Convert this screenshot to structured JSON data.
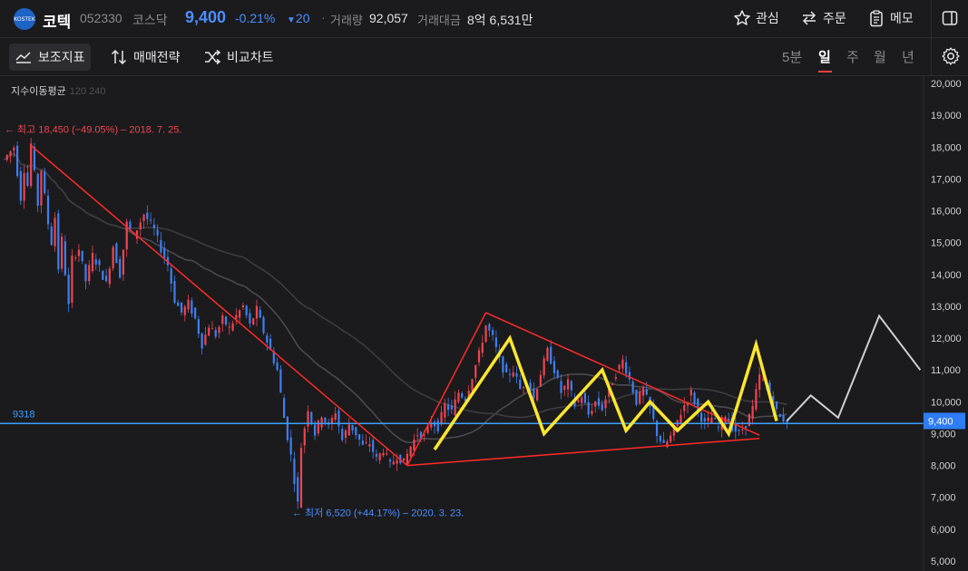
{
  "header": {
    "logo_text": "KOSTEK",
    "name": "코텍",
    "code": "052330",
    "market": "코스닥",
    "price": "9,400",
    "change_pct": "-0.21%",
    "change_arrow": "▼",
    "change_abs": "20",
    "separator": "·",
    "volume_label": "거래량",
    "volume": "92,057",
    "amount_label": "거래대금",
    "amount": "8억 6,531만",
    "watch_label": "관심",
    "order_label": "주문",
    "memo_label": "메모"
  },
  "toolbar": {
    "indicator_label": "보조지표",
    "strategy_label": "매매전략",
    "compare_label": "비교차트",
    "timeframes": [
      "5분",
      "일",
      "주",
      "월",
      "년"
    ],
    "selected_timeframe": "일"
  },
  "legend": {
    "ma_label": "지수이동평균",
    "ma_periods": "120 240"
  },
  "colors": {
    "up": "#f04452",
    "down": "#3f7ff0",
    "accent": "#4c8dff",
    "hline": "#3ba0ff",
    "trend": "#ff2a2a",
    "pattern": "#ffe62e",
    "projection": "#cfcfd2"
  },
  "chart_data": {
    "type": "candlestick",
    "y_axis": {
      "min": 5000,
      "max": 20000,
      "step": 1000,
      "position": "right",
      "tick_labels": [
        "20,000",
        "19,000",
        "18,000",
        "17,000",
        "16,000",
        "15,000",
        "14,000",
        "13,000",
        "12,000",
        "11,000",
        "10,000",
        "9,000",
        "8,000",
        "7,000",
        "6,000",
        "5,000"
      ]
    },
    "current_price": 9400,
    "current_price_label": "9,400",
    "horizontal_line": {
      "value": 9318,
      "label": "9318"
    },
    "annotations": {
      "high": {
        "text": "← 최고 18,450 (−49.05%) – 2018. 7. 25.",
        "value": 18450
      },
      "low": {
        "text": "← 최저 6,520 (+44.17%) – 2020. 3. 23.",
        "value": 6520
      }
    },
    "price_path": [
      [
        0,
        17600
      ],
      [
        3,
        18000
      ],
      [
        5,
        16400
      ],
      [
        6,
        17300
      ],
      [
        7,
        16800
      ],
      [
        8,
        18100
      ],
      [
        10,
        16200
      ],
      [
        11,
        17300
      ],
      [
        13,
        15600
      ],
      [
        14,
        15000
      ],
      [
        15,
        15800
      ],
      [
        16,
        14200
      ],
      [
        17,
        15100
      ],
      [
        19,
        13000
      ],
      [
        20,
        14500
      ],
      [
        22,
        14800
      ],
      [
        24,
        13800
      ],
      [
        26,
        14600
      ],
      [
        28,
        14200
      ],
      [
        30,
        13700
      ],
      [
        32,
        14900
      ],
      [
        34,
        14000
      ],
      [
        36,
        15600
      ],
      [
        38,
        15200
      ],
      [
        41,
        15900
      ],
      [
        44,
        15400
      ],
      [
        46,
        14800
      ],
      [
        48,
        14300
      ],
      [
        50,
        13200
      ],
      [
        52,
        12800
      ],
      [
        54,
        13100
      ],
      [
        56,
        12600
      ],
      [
        58,
        11800
      ],
      [
        60,
        12400
      ],
      [
        62,
        12100
      ],
      [
        64,
        12600
      ],
      [
        66,
        12300
      ],
      [
        68,
        12700
      ],
      [
        70,
        13000
      ],
      [
        72,
        12400
      ],
      [
        74,
        12900
      ],
      [
        76,
        12200
      ],
      [
        78,
        11600
      ],
      [
        80,
        11000
      ],
      [
        82,
        9500
      ],
      [
        84,
        8300
      ],
      [
        86,
        6800
      ],
      [
        87,
        8600
      ],
      [
        89,
        9800
      ],
      [
        91,
        9000
      ],
      [
        93,
        9600
      ],
      [
        95,
        9200
      ],
      [
        97,
        9700
      ],
      [
        99,
        8800
      ],
      [
        101,
        9300
      ],
      [
        103,
        9000
      ],
      [
        105,
        8600
      ],
      [
        107,
        8700
      ],
      [
        109,
        8200
      ],
      [
        111,
        8500
      ],
      [
        113,
        8000
      ],
      [
        115,
        8300
      ],
      [
        117,
        8100
      ],
      [
        119,
        8600
      ],
      [
        121,
        9000
      ],
      [
        123,
        8900
      ],
      [
        125,
        9400
      ],
      [
        127,
        9200
      ],
      [
        129,
        9900
      ],
      [
        131,
        9700
      ],
      [
        133,
        10300
      ],
      [
        135,
        10100
      ],
      [
        137,
        10800
      ],
      [
        139,
        11500
      ],
      [
        141,
        12400
      ],
      [
        143,
        12000
      ],
      [
        145,
        11300
      ],
      [
        147,
        10800
      ],
      [
        149,
        11000
      ],
      [
        151,
        10400
      ],
      [
        153,
        10700
      ],
      [
        155,
        10100
      ],
      [
        157,
        10900
      ],
      [
        159,
        11600
      ],
      [
        161,
        11000
      ],
      [
        163,
        10300
      ],
      [
        165,
        10600
      ],
      [
        167,
        9900
      ],
      [
        169,
        10200
      ],
      [
        171,
        9600
      ],
      [
        173,
        10000
      ],
      [
        175,
        9800
      ],
      [
        177,
        10400
      ],
      [
        179,
        10900
      ],
      [
        181,
        11300
      ],
      [
        183,
        10700
      ],
      [
        185,
        10000
      ],
      [
        187,
        10400
      ],
      [
        189,
        9800
      ],
      [
        191,
        9000
      ],
      [
        193,
        8600
      ],
      [
        195,
        8900
      ],
      [
        197,
        9400
      ],
      [
        199,
        9900
      ],
      [
        201,
        10300
      ],
      [
        203,
        9700
      ],
      [
        205,
        9300
      ],
      [
        207,
        9500
      ],
      [
        209,
        9200
      ],
      [
        211,
        9600
      ],
      [
        213,
        9200
      ],
      [
        215,
        9000
      ],
      [
        217,
        9300
      ],
      [
        219,
        9800
      ],
      [
        221,
        10800
      ],
      [
        223,
        10500
      ],
      [
        225,
        9900
      ],
      [
        227,
        9500
      ],
      [
        229,
        9400
      ]
    ],
    "trend_lines": [
      [
        [
          8,
          18050
        ],
        [
          118,
          8000
        ]
      ],
      [
        [
          118,
          8000
        ],
        [
          141,
          12800
        ]
      ],
      [
        [
          141,
          12800
        ],
        [
          221,
          8950
        ]
      ],
      [
        [
          118,
          8000
        ],
        [
          221,
          8850
        ]
      ]
    ],
    "zigzag": [
      [
        126,
        8500
      ],
      [
        148,
        12000
      ],
      [
        158,
        9000
      ],
      [
        175,
        11000
      ],
      [
        182,
        9100
      ],
      [
        189,
        10000
      ],
      [
        197,
        9100
      ],
      [
        206,
        10000
      ],
      [
        212,
        9000
      ],
      [
        220,
        11800
      ],
      [
        226,
        9400
      ]
    ],
    "projection": [
      [
        229,
        9400
      ],
      [
        236,
        10200
      ],
      [
        244,
        9500
      ],
      [
        256,
        12700
      ],
      [
        268,
        11000
      ]
    ]
  }
}
